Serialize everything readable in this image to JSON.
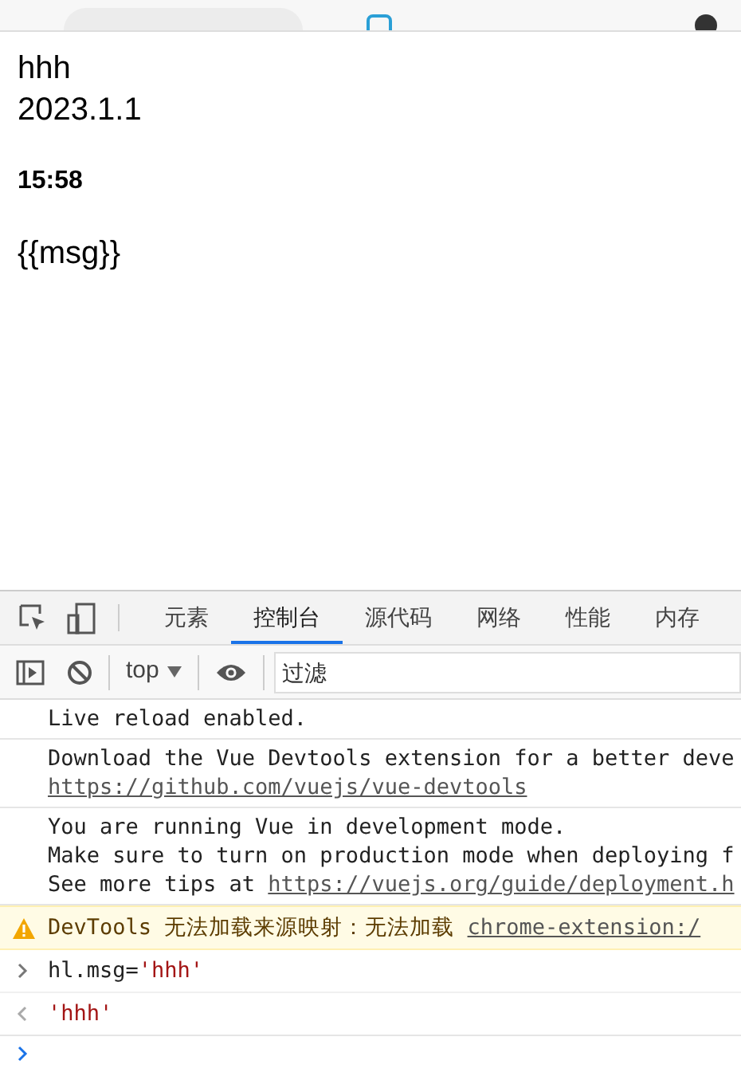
{
  "page": {
    "lines": [
      {
        "kind": "text",
        "text": "hhh"
      },
      {
        "kind": "text",
        "text": "2023.1.1"
      },
      {
        "kind": "heading",
        "text": "15:58"
      },
      {
        "kind": "text",
        "text": "{{msg}}"
      }
    ]
  },
  "devtools": {
    "tabs": [
      {
        "label": "元素",
        "selected": false
      },
      {
        "label": "控制台",
        "selected": true
      },
      {
        "label": "源代码",
        "selected": false
      },
      {
        "label": "网络",
        "selected": false
      },
      {
        "label": "性能",
        "selected": false
      },
      {
        "label": "内存",
        "selected": false
      }
    ],
    "context": "top",
    "filter": {
      "placeholder": "过滤"
    },
    "messages": [
      {
        "kind": "log",
        "lines": [
          {
            "text": "Live reload enabled."
          }
        ]
      },
      {
        "kind": "log",
        "lines": [
          {
            "text": "Download the Vue Devtools extension for a better deve"
          },
          {
            "link": "https://github.com/vuejs/vue-devtools"
          }
        ]
      },
      {
        "kind": "log",
        "lines": [
          {
            "text": "You are running Vue in development mode."
          },
          {
            "text": "Make sure to turn on production mode when deploying f"
          },
          {
            "text": "See more tips at ",
            "link": "https://vuejs.org/guide/deployment.h"
          }
        ]
      },
      {
        "kind": "warning",
        "lines": [
          {
            "text": "DevTools 无法加载来源映射：无法加载 ",
            "link": "chrome-extension:/"
          }
        ]
      },
      {
        "kind": "input",
        "code": "hl.msg=",
        "string": "'hhh'"
      },
      {
        "kind": "output",
        "string": "'hhh'"
      },
      {
        "kind": "prompt"
      }
    ]
  }
}
